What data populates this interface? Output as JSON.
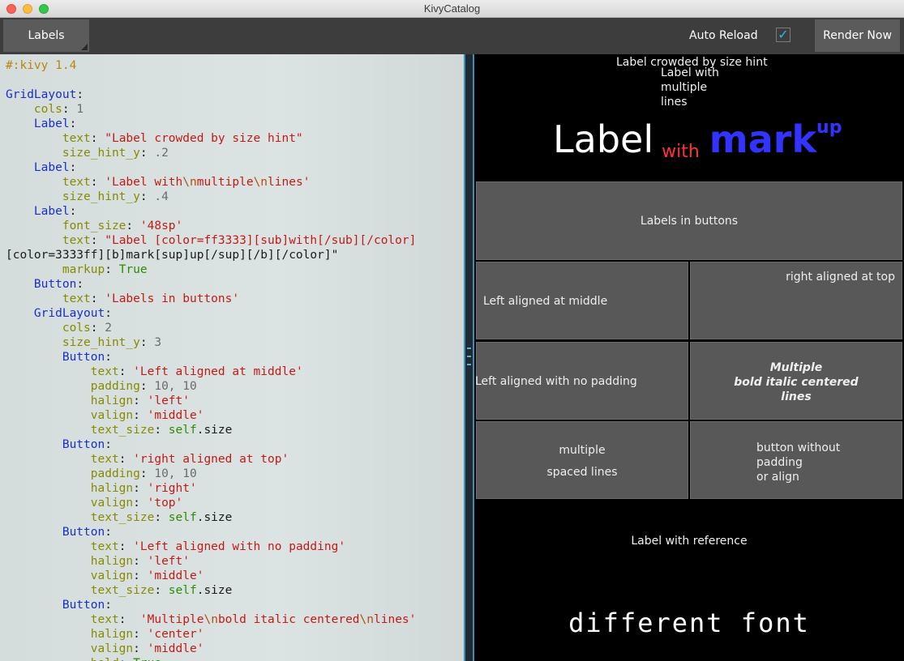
{
  "window": {
    "title": "KivyCatalog"
  },
  "toolbar": {
    "spinner_label": "Labels",
    "auto_reload_label": "Auto Reload",
    "auto_reload_checked": true,
    "render_label": "Render Now"
  },
  "colors": {
    "accent": "#33b5e5",
    "markup_red": "#ff3333",
    "markup_blue": "#3333ff",
    "button_bg": "#585858"
  },
  "code_lines": [
    [
      [
        "#:kivy 1.4",
        "c-dir"
      ]
    ],
    [],
    [
      [
        "GridLayout",
        "c-cls"
      ],
      [
        ":",
        "c-plain"
      ]
    ],
    [
      [
        "    cols",
        "c-prop"
      ],
      [
        ": ",
        "c-plain"
      ],
      [
        "1",
        "c-num"
      ]
    ],
    [
      [
        "    Label",
        "c-cls"
      ],
      [
        ":",
        "c-plain"
      ]
    ],
    [
      [
        "        text",
        "c-prop"
      ],
      [
        ": ",
        "c-plain"
      ],
      [
        "\"Label crowded by size hint\"",
        "c-str"
      ]
    ],
    [
      [
        "        size_hint_y",
        "c-prop"
      ],
      [
        ": ",
        "c-plain"
      ],
      [
        ".2",
        "c-num"
      ]
    ],
    [
      [
        "    Label",
        "c-cls"
      ],
      [
        ":",
        "c-plain"
      ]
    ],
    [
      [
        "        text",
        "c-prop"
      ],
      [
        ": ",
        "c-plain"
      ],
      [
        "'Label with",
        "c-str"
      ],
      [
        "\\n",
        "c-esc"
      ],
      [
        "multiple",
        "c-str"
      ],
      [
        "\\n",
        "c-esc"
      ],
      [
        "lines'",
        "c-str"
      ]
    ],
    [
      [
        "        size_hint_y",
        "c-prop"
      ],
      [
        ": ",
        "c-plain"
      ],
      [
        ".4",
        "c-num"
      ]
    ],
    [
      [
        "    Label",
        "c-cls"
      ],
      [
        ":",
        "c-plain"
      ]
    ],
    [
      [
        "        font_size",
        "c-prop"
      ],
      [
        ": ",
        "c-plain"
      ],
      [
        "'48sp'",
        "c-str"
      ]
    ],
    [
      [
        "        text",
        "c-prop"
      ],
      [
        ": ",
        "c-plain"
      ],
      [
        "\"Label [color=ff3333][sub]with[/sub][/color]",
        "c-str"
      ]
    ],
    [
      [
        "[color=3333ff][b]mark[sup]up[/sup][/b][/color]\"",
        "c-plain"
      ]
    ],
    [
      [
        "        markup",
        "c-prop"
      ],
      [
        ": ",
        "c-plain"
      ],
      [
        "True",
        "c-kw"
      ]
    ],
    [
      [
        "    Button",
        "c-cls"
      ],
      [
        ":",
        "c-plain"
      ]
    ],
    [
      [
        "        text",
        "c-prop"
      ],
      [
        ": ",
        "c-plain"
      ],
      [
        "'Labels in buttons'",
        "c-str"
      ]
    ],
    [
      [
        "    GridLayout",
        "c-cls"
      ],
      [
        ":",
        "c-plain"
      ]
    ],
    [
      [
        "        cols",
        "c-prop"
      ],
      [
        ": ",
        "c-plain"
      ],
      [
        "2",
        "c-num"
      ]
    ],
    [
      [
        "        size_hint_y",
        "c-prop"
      ],
      [
        ": ",
        "c-plain"
      ],
      [
        "3",
        "c-num"
      ]
    ],
    [
      [
        "        Button",
        "c-cls"
      ],
      [
        ":",
        "c-plain"
      ]
    ],
    [
      [
        "            text",
        "c-prop"
      ],
      [
        ": ",
        "c-plain"
      ],
      [
        "'Left aligned at middle'",
        "c-str"
      ]
    ],
    [
      [
        "            padding",
        "c-prop"
      ],
      [
        ": ",
        "c-plain"
      ],
      [
        "10, 10",
        "c-num"
      ]
    ],
    [
      [
        "            halign",
        "c-prop"
      ],
      [
        ": ",
        "c-plain"
      ],
      [
        "'left'",
        "c-str"
      ]
    ],
    [
      [
        "            valign",
        "c-prop"
      ],
      [
        ": ",
        "c-plain"
      ],
      [
        "'middle'",
        "c-str"
      ]
    ],
    [
      [
        "            text_size",
        "c-prop"
      ],
      [
        ": ",
        "c-plain"
      ],
      [
        "self",
        "c-kw"
      ],
      [
        ".size",
        "c-plain"
      ]
    ],
    [
      [
        "        Button",
        "c-cls"
      ],
      [
        ":",
        "c-plain"
      ]
    ],
    [
      [
        "            text",
        "c-prop"
      ],
      [
        ": ",
        "c-plain"
      ],
      [
        "'right aligned at top'",
        "c-str"
      ]
    ],
    [
      [
        "            padding",
        "c-prop"
      ],
      [
        ": ",
        "c-plain"
      ],
      [
        "10, 10",
        "c-num"
      ]
    ],
    [
      [
        "            halign",
        "c-prop"
      ],
      [
        ": ",
        "c-plain"
      ],
      [
        "'right'",
        "c-str"
      ]
    ],
    [
      [
        "            valign",
        "c-prop"
      ],
      [
        ": ",
        "c-plain"
      ],
      [
        "'top'",
        "c-str"
      ]
    ],
    [
      [
        "            text_size",
        "c-prop"
      ],
      [
        ": ",
        "c-plain"
      ],
      [
        "self",
        "c-kw"
      ],
      [
        ".size",
        "c-plain"
      ]
    ],
    [
      [
        "        Button",
        "c-cls"
      ],
      [
        ":",
        "c-plain"
      ]
    ],
    [
      [
        "            text",
        "c-prop"
      ],
      [
        ": ",
        "c-plain"
      ],
      [
        "'Left aligned with no padding'",
        "c-str"
      ]
    ],
    [
      [
        "            halign",
        "c-prop"
      ],
      [
        ": ",
        "c-plain"
      ],
      [
        "'left'",
        "c-str"
      ]
    ],
    [
      [
        "            valign",
        "c-prop"
      ],
      [
        ": ",
        "c-plain"
      ],
      [
        "'middle'",
        "c-str"
      ]
    ],
    [
      [
        "            text_size",
        "c-prop"
      ],
      [
        ": ",
        "c-plain"
      ],
      [
        "self",
        "c-kw"
      ],
      [
        ".size",
        "c-plain"
      ]
    ],
    [
      [
        "        Button",
        "c-cls"
      ],
      [
        ":",
        "c-plain"
      ]
    ],
    [
      [
        "            text",
        "c-prop"
      ],
      [
        ": ",
        "c-plain"
      ],
      [
        " 'Multiple",
        "c-str"
      ],
      [
        "\\n",
        "c-esc"
      ],
      [
        "bold italic centered",
        "c-str"
      ],
      [
        "\\n",
        "c-esc"
      ],
      [
        "lines'",
        "c-str"
      ]
    ],
    [
      [
        "            halign",
        "c-prop"
      ],
      [
        ": ",
        "c-plain"
      ],
      [
        "'center'",
        "c-str"
      ]
    ],
    [
      [
        "            valign",
        "c-prop"
      ],
      [
        ": ",
        "c-plain"
      ],
      [
        "'middle'",
        "c-str"
      ]
    ],
    [
      [
        "            bold",
        "c-prop"
      ],
      [
        ": ",
        "c-plain"
      ],
      [
        "True",
        "c-kw"
      ]
    ]
  ],
  "preview": {
    "crowded": "Label crowded by size hint",
    "multiline": [
      "Label with",
      "multiple",
      "lines"
    ],
    "markup": {
      "label": "Label",
      "sub": "with",
      "mark": "mark",
      "sup": "up"
    },
    "labels_in_buttons": "Labels in buttons",
    "left_middle": "Left aligned at middle",
    "right_top": "right aligned at top",
    "left_no_padding": "Left aligned with no padding",
    "bold_italic": [
      "Multiple",
      "bold italic centered",
      "lines"
    ],
    "spaced": [
      "multiple",
      "spaced lines"
    ],
    "no_padding": [
      "button without",
      "padding",
      "or align"
    ],
    "reference": "Label with reference",
    "different_font": "different font"
  }
}
